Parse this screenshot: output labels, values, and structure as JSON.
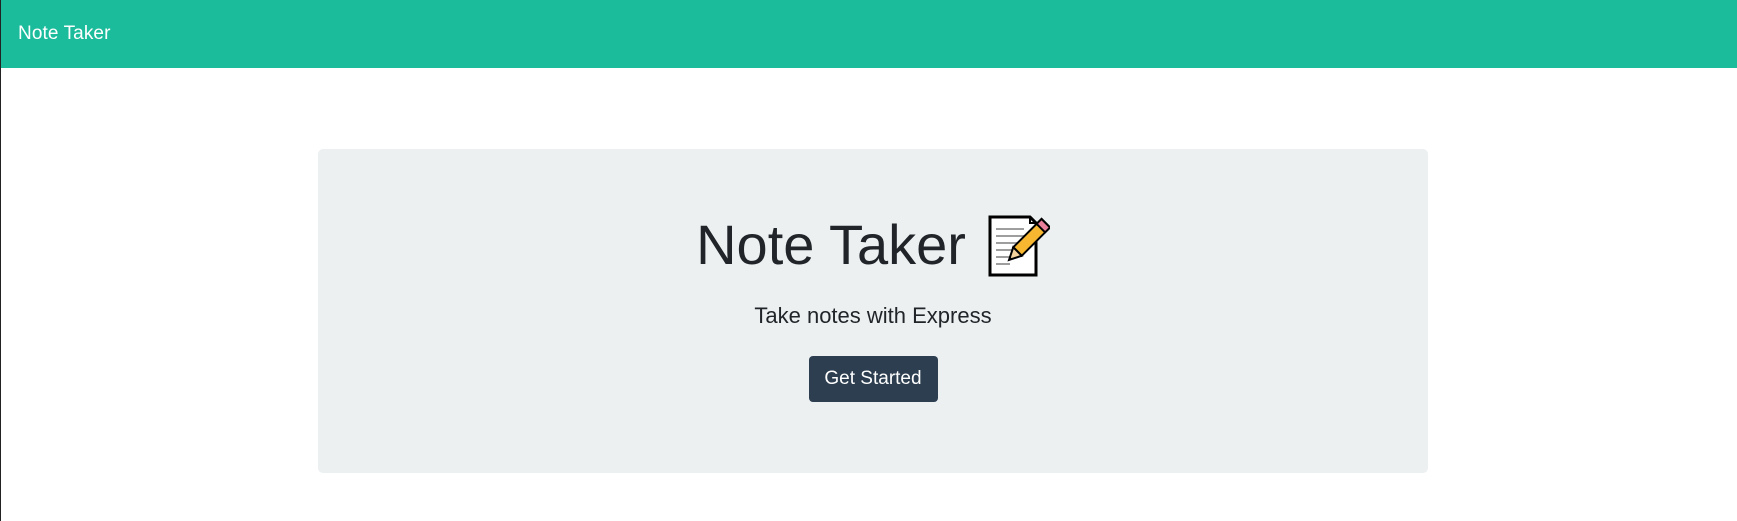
{
  "navbar": {
    "brand": "Note Taker"
  },
  "hero": {
    "title": "Note Taker",
    "icon": "memo-icon",
    "subtitle": "Take notes with Express",
    "button_label": "Get Started"
  },
  "colors": {
    "navbar_bg": "#1abc9c",
    "jumbotron_bg": "#ecf0f1",
    "button_bg": "#2c3e50",
    "text": "#212529"
  }
}
